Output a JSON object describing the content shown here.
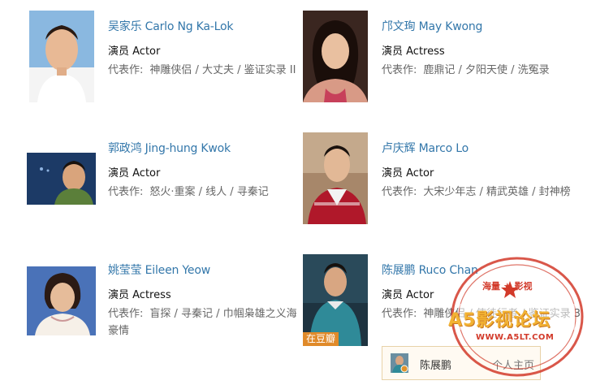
{
  "people": [
    {
      "name": "吴家乐 Carlo Ng Ka-Lok",
      "role": "演员 Actor",
      "works_label": "代表作:",
      "works": "神雕侠侣 / 大丈夫 / 鉴证实录 II"
    },
    {
      "name": "邝文珣 May Kwong",
      "role": "演员 Actress",
      "works_label": "代表作:",
      "works": "鹿鼎记 / 夕阳天使 / 洗冤录"
    },
    {
      "name": "郭政鸿 Jing-hung Kwok",
      "role": "演员 Actor",
      "works_label": "代表作:",
      "works": "怒火·重案 / 线人 / 寻秦记"
    },
    {
      "name": "卢庆辉 Marco Lo",
      "role": "演员 Actor",
      "works_label": "代表作:",
      "works": "大宋少年志 / 精武英雄 / 封神榜"
    },
    {
      "name": "姚莹莹 Eileen Yeow",
      "role": "演员 Actress",
      "works_label": "代表作:",
      "works": "盲探 / 寻秦记 / 巾帼枭雄之义海豪情"
    },
    {
      "name": "陈展鹏 Ruco Chan",
      "role": "演员 Actor",
      "works_label": "代表作:",
      "works": "神雕侠侣 / 使徒行者 / 鉴证实录 3"
    }
  ],
  "douban_tag": "在豆瓣",
  "popup": {
    "name": "陈展鹏",
    "link": "个人主页"
  },
  "watermark": {
    "top": "海量 ★ 影视",
    "main": "A5影视论坛",
    "url": "WWW.A5LT.COM"
  },
  "colors": {
    "link": "#3377aa",
    "tag": "#e08a2a",
    "stamp_red": "#d23a2a",
    "stamp_gold": "#f2b233"
  }
}
